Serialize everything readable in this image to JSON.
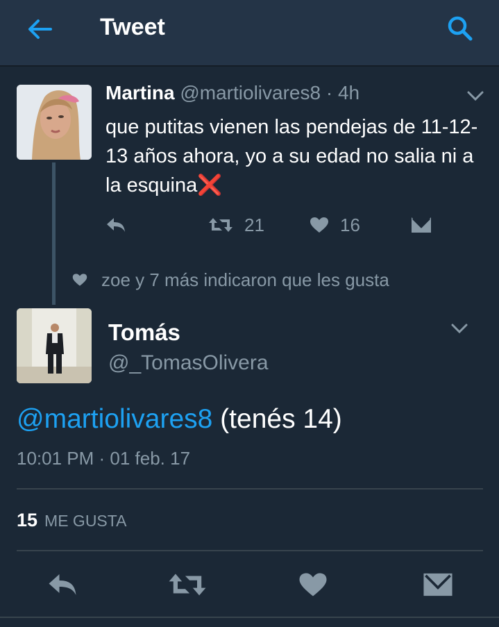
{
  "header": {
    "title": "Tweet",
    "back_icon": "arrow-left-icon",
    "search_icon": "search-icon",
    "accent": "#1da1f2"
  },
  "parent_tweet": {
    "name": "Martina",
    "handle": "@martiolivares8",
    "time": "· 4h",
    "text": "que putitas vienen las pendejas de 11-12-13 años ahora, yo a su edad no salia ni a la esquina",
    "emoji": "❌",
    "retweets": "21",
    "likes": "16",
    "liked_by": "zoe y 7 más indicaron que les gusta"
  },
  "main_tweet": {
    "name": "Tomás",
    "handle": "@_TomasOlivera",
    "mention": "@martiolivares8",
    "text": " (tenés 14)",
    "timestamp": "10:01 PM · 01 feb. 17",
    "likes_count": "15",
    "likes_label": "ME GUSTA"
  },
  "colors": {
    "background": "#1b2836",
    "header": "#243447",
    "muted": "#8899a6",
    "link": "#1da1f2"
  }
}
